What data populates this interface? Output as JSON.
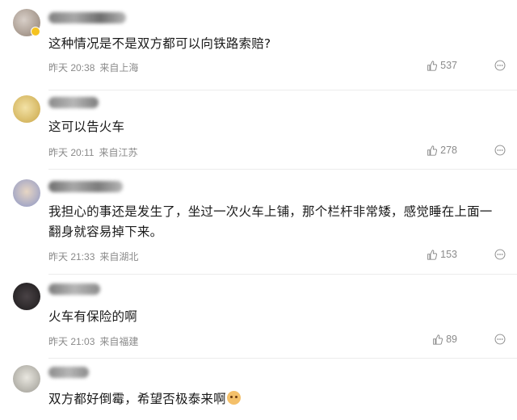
{
  "comments": [
    {
      "text": "这种情况是不是双方都可以向铁路索赔?",
      "time": "昨天 20:38",
      "location": "来自上海",
      "likes": "537",
      "avatar_color": "#b9a89a",
      "badge": true
    },
    {
      "text": "这可以告火车",
      "time": "昨天 20:11",
      "location": "来自江苏",
      "likes": "278",
      "avatar_color": "#e3c46a",
      "badge": false
    },
    {
      "text": "我担心的事还是发生了，坐过一次火车上铺，那个栏杆非常矮，感觉睡在上面一翻身就容易掉下来。",
      "time": "昨天 21:33",
      "location": "来自湖北",
      "likes": "153",
      "avatar_color": "#9aa3c9",
      "badge": false
    },
    {
      "text": "火车有保险的啊",
      "time": "昨天 21:03",
      "location": "来自福建",
      "likes": "89",
      "avatar_color": "#2d2a2b",
      "badge": false
    },
    {
      "text": "双方都好倒霉，希望否极泰来啊",
      "time": "",
      "location": "",
      "likes": "",
      "avatar_color": "#c9c7bf",
      "badge": false,
      "emoji": "dog-face-emoji"
    }
  ],
  "icons": {
    "like": "thumbs-up-icon",
    "more": "more-dots-icon"
  }
}
